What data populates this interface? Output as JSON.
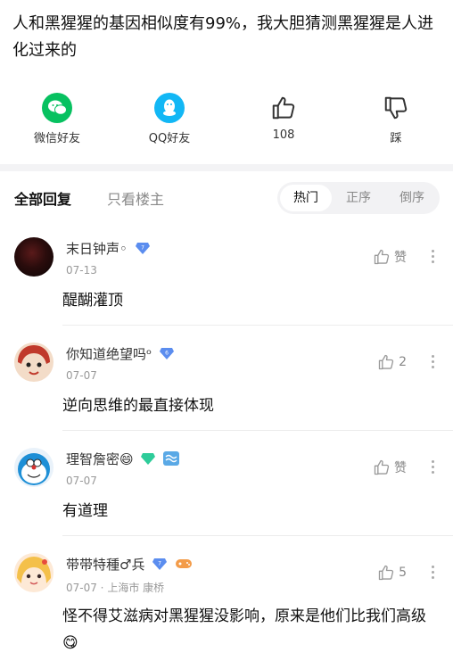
{
  "post": {
    "title": "人和黑猩猩的基因相似度有99%，我大胆猜测黑猩猩是人进化过来的"
  },
  "share": {
    "wechat_label": "微信好友",
    "qq_label": "QQ好友",
    "like_count": "108",
    "dislike_label": "踩"
  },
  "replies": {
    "tab_all": "全部回复",
    "tab_op_only": "只看楼主",
    "sort_hot": "热门",
    "sort_asc": "正序",
    "sort_desc": "倒序"
  },
  "comments": [
    {
      "username": "末日钟声◦",
      "meta": "07-13",
      "text": "醍醐灌顶",
      "like_label": "赞"
    },
    {
      "username": "你知道绝望吗ᵒ",
      "meta": "07-07",
      "text": "逆向思维的最直接体现",
      "like_label": "2"
    },
    {
      "username": "理智詹密😄",
      "meta": "07-07",
      "text": "有道理",
      "like_label": "赞"
    },
    {
      "username": "带带特種♂兵",
      "meta": "07-07 · 上海市 康桥",
      "text": "怪不得艾滋病对黑猩猩没影响，原来是他们比我们高级 😋",
      "like_label": "5"
    }
  ],
  "colors": {
    "wechat_green": "#07c160",
    "qq_blue": "#12b7f5",
    "vip_blue": "#5b8def"
  }
}
